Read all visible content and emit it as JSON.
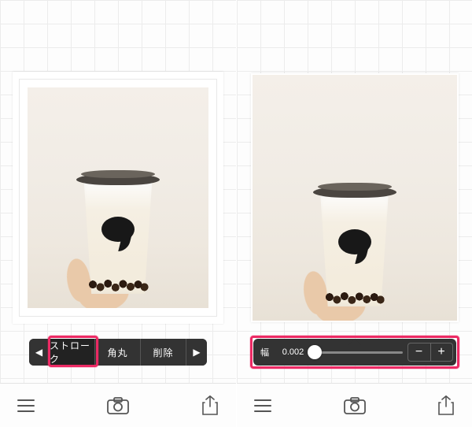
{
  "left": {
    "segmented": {
      "prev_glyph": "◀",
      "next_glyph": "▶",
      "options": [
        {
          "label": "ストローク",
          "selected": true
        },
        {
          "label": "角丸",
          "selected": false
        },
        {
          "label": "削除",
          "selected": false
        }
      ]
    }
  },
  "right": {
    "width_control": {
      "label": "幅",
      "value": "0.002",
      "minus": "−",
      "plus": "+"
    }
  },
  "colors": {
    "highlight": "#ec2a64",
    "popover_bg": "#333333"
  }
}
